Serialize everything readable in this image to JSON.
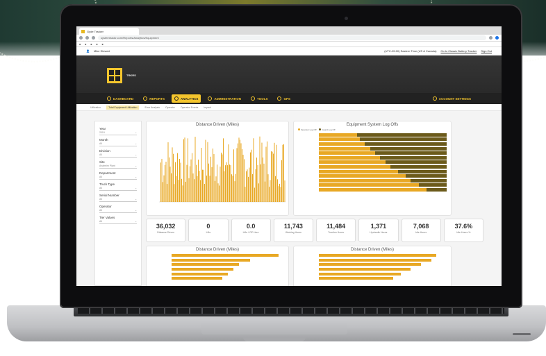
{
  "browser": {
    "tab_title": "Gyde Tracker",
    "url": "systemtrackr.com/Reports/Analytics/Equipment"
  },
  "userbar": {
    "user": "Mike Stewart",
    "timezone": "(UTC-05:00) Eastern Time (US & Canada)",
    "legacy_link": "Go to Classic Battery Tracker",
    "signout": "Sign Out"
  },
  "brand": {
    "name": "TRKRS"
  },
  "nav": {
    "dashboard": "DASHBOARD",
    "reports": "REPORTS",
    "analytics": "ANALYTICS",
    "administration": "ADMINISTRATION",
    "tools": "TOOLS",
    "gps": "GPS",
    "account": "ACCOUNT SETTINGS"
  },
  "subtabs": [
    "Utilization",
    "Total Equipment Utilization",
    "Error Analysis",
    "Operator",
    "Operator Events",
    "Impact"
  ],
  "filters": [
    {
      "label": "Year",
      "value": "2019"
    },
    {
      "label": "Month",
      "value": "All"
    },
    {
      "label": "Division",
      "value": "All"
    },
    {
      "label": "Site",
      "value": "Anaheim Plant"
    },
    {
      "label": "Department",
      "value": "All"
    },
    {
      "label": "Truck Type",
      "value": "All"
    },
    {
      "label": "Serial Number",
      "value": "All"
    },
    {
      "label": "Operator",
      "value": "All"
    },
    {
      "label": "Tier Values",
      "value": "All"
    }
  ],
  "panels": {
    "distance_title": "Distance Driven (Miles)",
    "log_offs_title": "Equipment System Log Offs",
    "bottom_left_title": "Distance Driven (Miles)",
    "bottom_right_title": "Distance Driven (Miles)",
    "legend_a": "Operator Log Off",
    "legend_b": "Guard Log Off"
  },
  "kpis": [
    {
      "value": "36,032",
      "label": "Distance Driven"
    },
    {
      "value": "0",
      "label": "Lifts"
    },
    {
      "value": "0.0",
      "label": "Lifts / OP Hour"
    },
    {
      "value": "11,743",
      "label": "Working Hours"
    },
    {
      "value": "11,484",
      "label": "Traction Hours"
    },
    {
      "value": "1,371",
      "label": "Hydraulic Hours"
    },
    {
      "value": "7,068",
      "label": "Idle Hours"
    },
    {
      "value": "37.6%",
      "label": "Idle Hours %"
    }
  ],
  "colors": {
    "accent": "#f4c52d",
    "bar": "#e8a824",
    "bar_dark": "#6b5a1a",
    "header": "#2a2a2a"
  }
}
